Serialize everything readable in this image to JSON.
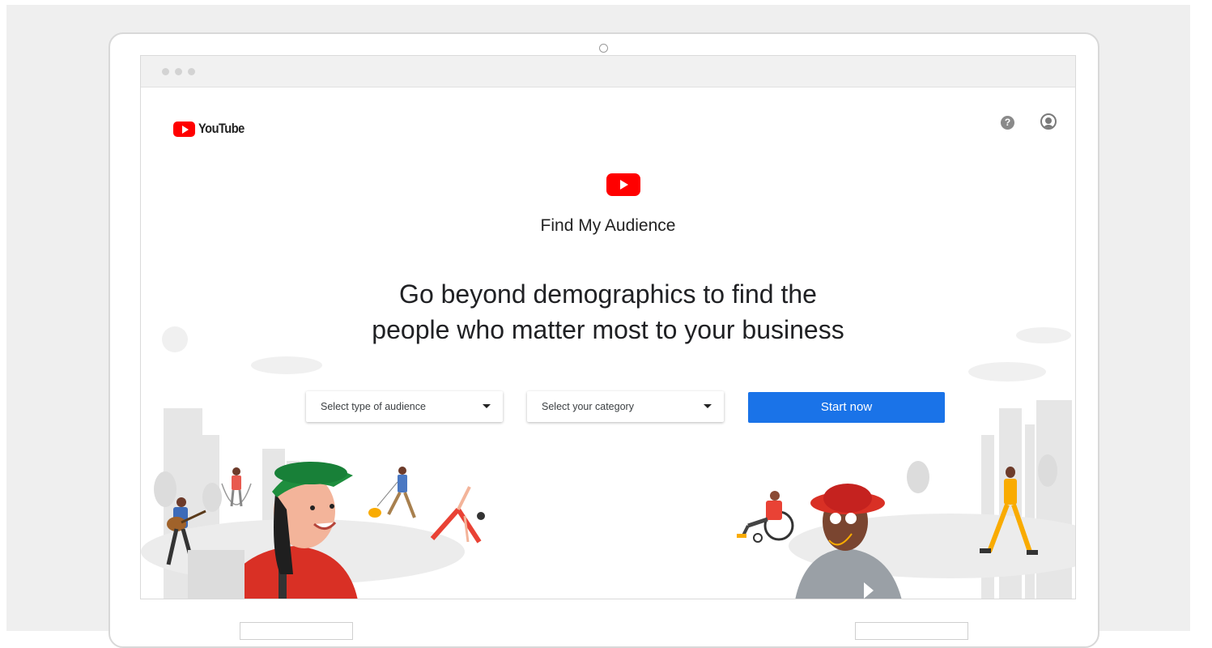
{
  "brand": {
    "wordmark": "YouTube"
  },
  "header": {
    "help_icon": "help-circle-icon",
    "account_icon": "account-circle-icon"
  },
  "hero": {
    "title": "Find My Audience",
    "headline_line1": "Go beyond demographics to find the",
    "headline_line2": "people who matter most to your business"
  },
  "form": {
    "audience_select_label": "Select type of audience",
    "category_select_label": "Select your category",
    "start_button_label": "Start now"
  },
  "colors": {
    "brand_red": "#ff0000",
    "button_blue": "#1a73e8",
    "text": "#202124"
  }
}
